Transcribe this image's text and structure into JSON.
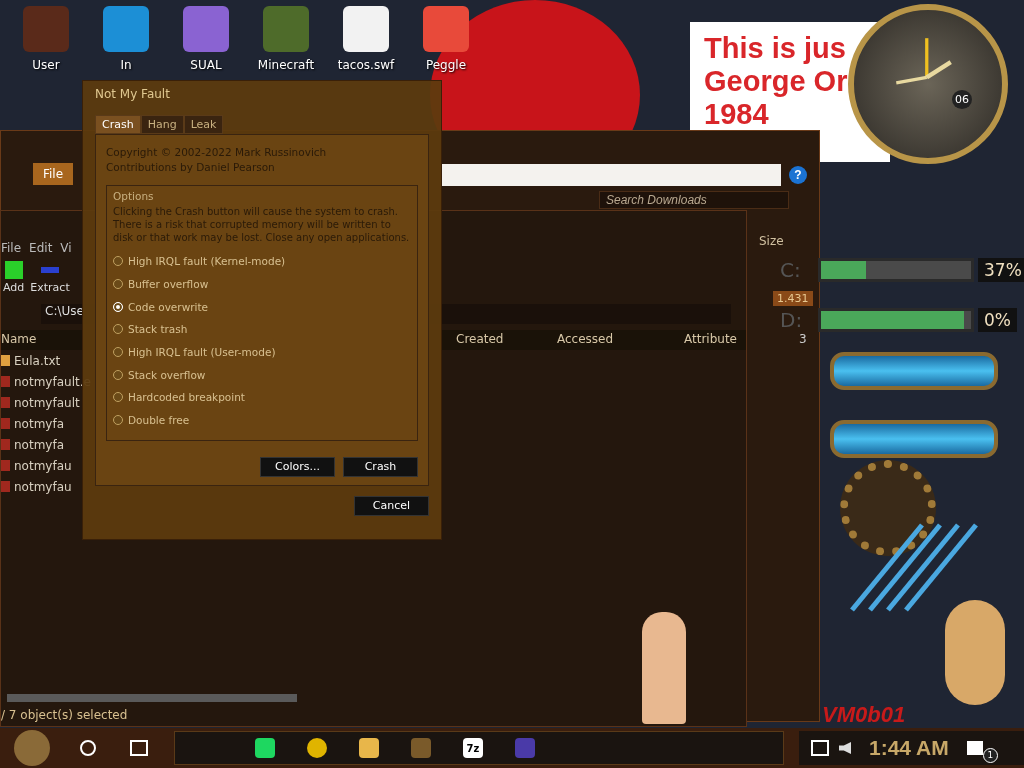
{
  "desktop_icons": [
    {
      "label": "User",
      "kind": "user"
    },
    {
      "label": "In",
      "kind": "browser"
    },
    {
      "label": "SUAL",
      "kind": "studio"
    },
    {
      "label": "Minecraft",
      "kind": "block"
    },
    {
      "label": "tacos.swf",
      "kind": "file"
    },
    {
      "label": "Peggle",
      "kind": "game"
    }
  ],
  "note": {
    "lines": [
      "This is jus",
      "George Or",
      "1984"
    ]
  },
  "clock": {
    "date": "06"
  },
  "drive_meters": [
    {
      "drive": "C:",
      "reading": "37%",
      "level": 0.3
    },
    {
      "drive": "D:",
      "reading": "0%",
      "level": 0.95
    }
  ],
  "explorer": {
    "file_tab": "File",
    "search": {
      "placeholder": "Search Downloads"
    },
    "help": "?",
    "size_column": "Size",
    "badge": "1.431"
  },
  "archive_window": {
    "menu": [
      "File",
      "Edit",
      "Vi"
    ],
    "toolbar": [
      "Add",
      "Extract"
    ],
    "path": "C:\\Use",
    "columns": [
      "Name",
      "Created",
      "Accessed",
      "Attribute"
    ],
    "extra_count": "3",
    "files": [
      {
        "name": "Eula.txt",
        "kind": "text"
      },
      {
        "name": "notmyfault.e",
        "kind": "app"
      },
      {
        "name": "notmyfault",
        "kind": "app"
      },
      {
        "name": "notmyfa",
        "kind": "app"
      },
      {
        "name": "notmyfa",
        "kind": "app"
      },
      {
        "name": "notmyfau",
        "kind": "app"
      },
      {
        "name": "notmyfau",
        "kind": "app"
      }
    ],
    "status": "/ 7 object(s) selected"
  },
  "dialog": {
    "title": "Not My Fault",
    "tabs": [
      {
        "label": "Crash",
        "selected": true
      },
      {
        "label": "Hang",
        "selected": false
      },
      {
        "label": "Leak",
        "selected": false
      }
    ],
    "copyright": [
      "Copyright © 2002-2022 Mark Russinovich",
      "Contributions by Daniel Pearson"
    ],
    "group_title": "Options",
    "description": "Clicking the Crash button will cause the system to crash. There is a risk that corrupted memory will be written to disk or that work may be lost. Close any open applications.",
    "options": [
      {
        "label": "High IRQL fault (Kernel-mode)",
        "selected": false
      },
      {
        "label": "Buffer overflow",
        "selected": false
      },
      {
        "label": "Code overwrite",
        "selected": true
      },
      {
        "label": "Stack trash",
        "selected": false
      },
      {
        "label": "High IRQL fault (User-mode)",
        "selected": false
      },
      {
        "label": "Stack overflow",
        "selected": false
      },
      {
        "label": "Hardcoded breakpoint",
        "selected": false
      },
      {
        "label": "Double free",
        "selected": false
      }
    ],
    "buttons": [
      "Colors...",
      "Crash"
    ],
    "cancel": "Cancel"
  },
  "vm_label": "VM0b01",
  "taskbar": {
    "apps": [
      {
        "kind": "notes"
      },
      {
        "kind": "chrome"
      },
      {
        "kind": "folder"
      },
      {
        "kind": "game"
      },
      {
        "kind": "zip",
        "label": "7z"
      },
      {
        "kind": "window"
      }
    ],
    "time": "1:44 AM",
    "notifications": "1"
  }
}
